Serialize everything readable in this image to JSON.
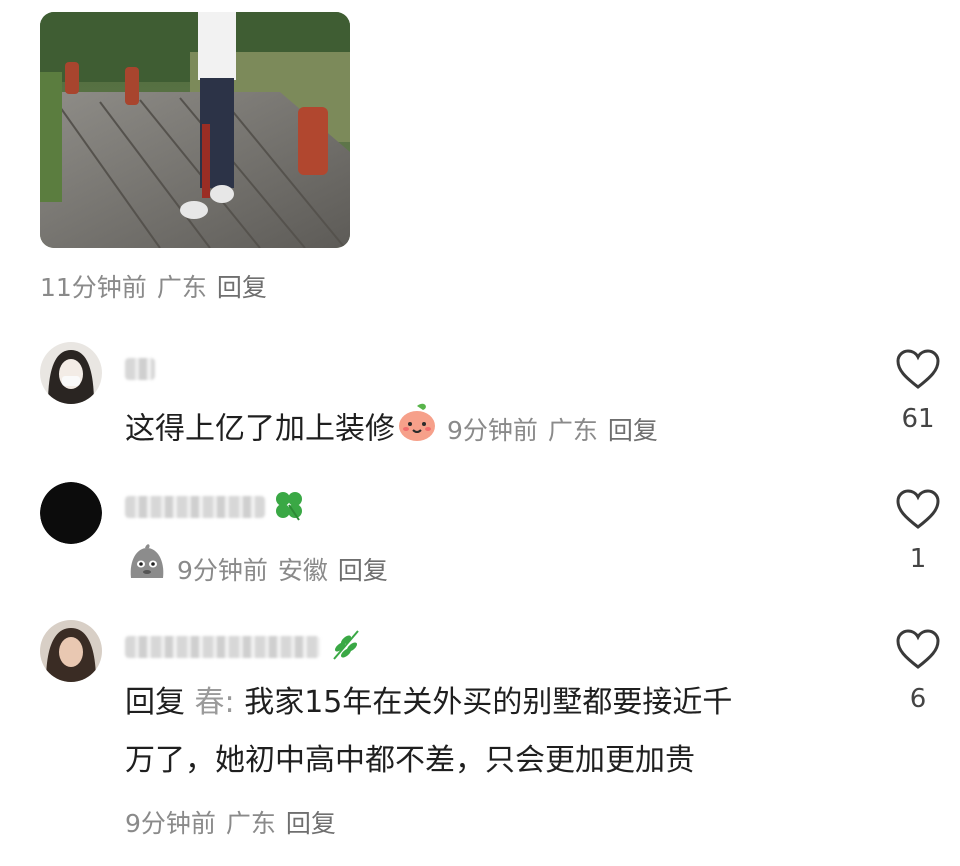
{
  "top_post": {
    "time": "11分钟前",
    "location": "广东",
    "reply": "回复"
  },
  "comments": [
    {
      "text": "这得上亿了加上装修",
      "emoji": "peach-face-emoji",
      "time": "9分钟前",
      "location": "广东",
      "reply": "回复",
      "likes": "61"
    },
    {
      "name_badge": "clover-emoji",
      "emoji": "pouting-blob-emoji",
      "time": "9分钟前",
      "location": "安徽",
      "reply": "回复",
      "likes": "1"
    },
    {
      "name_badge": "leaf-emoji",
      "reply_prefix": "回复",
      "reply_to": "春:",
      "text_line1": "我家15年在关外买的别墅都要接近千",
      "text_line2": "万了，她初中高中都不差，只会更加更加贵",
      "time": "9分钟前",
      "location": "广东",
      "reply": "回复",
      "likes": "6"
    }
  ],
  "icons": {
    "like": "heart-outline-icon"
  },
  "colors": {
    "meta_text": "#8a8a8a",
    "body_text": "#1f1f1f",
    "emoji_green": "#3aa845",
    "emoji_peach": "#f6a08a"
  }
}
